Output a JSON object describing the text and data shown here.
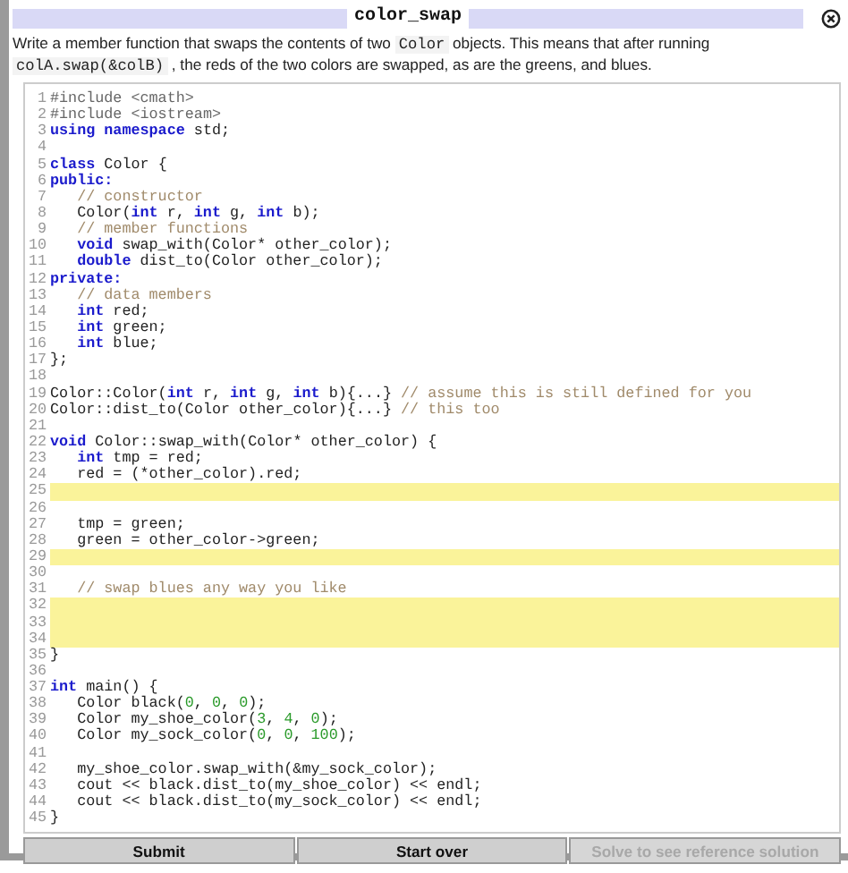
{
  "title": "color_swap",
  "description": [
    {
      "kind": "text",
      "text": "Write a member function that swaps the contents of two "
    },
    {
      "kind": "code",
      "text": "Color"
    },
    {
      "kind": "text",
      "text": " objects. This means that after running "
    },
    {
      "kind": "code",
      "text": "colA.swap(&colB)"
    },
    {
      "kind": "text",
      "text": " , the reds of the two colors are swapped, as are the greens, and blues."
    }
  ],
  "code_lines": [
    {
      "number": "1",
      "highlighted": false,
      "indented": false,
      "tokens": [
        {
          "kind": "preprocessor",
          "text": "#include <cmath>"
        }
      ]
    },
    {
      "number": "2",
      "highlighted": false,
      "indented": false,
      "tokens": [
        {
          "kind": "preprocessor",
          "text": "#include <iostream>"
        }
      ]
    },
    {
      "number": "3",
      "highlighted": false,
      "indented": false,
      "tokens": [
        {
          "kind": "keyword",
          "text": "using namespace"
        },
        {
          "kind": "plain",
          "text": " std;"
        }
      ]
    },
    {
      "number": "4",
      "highlighted": false
    },
    {
      "number": "5",
      "highlighted": false,
      "indented": false,
      "tokens": [
        {
          "kind": "keyword",
          "text": "class"
        },
        {
          "kind": "plain",
          "text": " Color {"
        }
      ]
    },
    {
      "number": "6",
      "highlighted": false,
      "indented": false,
      "tokens": [
        {
          "kind": "keyword",
          "text": "public:"
        }
      ]
    },
    {
      "number": "7",
      "highlighted": false,
      "indented": true,
      "tokens": [
        {
          "kind": "comment",
          "text": "// constructor"
        }
      ]
    },
    {
      "number": "8",
      "highlighted": false,
      "indented": true,
      "tokens": [
        {
          "kind": "plain",
          "text": "Color("
        },
        {
          "kind": "keyword",
          "text": "int"
        },
        {
          "kind": "plain",
          "text": " r, "
        },
        {
          "kind": "keyword",
          "text": "int"
        },
        {
          "kind": "plain",
          "text": " g, "
        },
        {
          "kind": "keyword",
          "text": "int"
        },
        {
          "kind": "plain",
          "text": " b);"
        }
      ]
    },
    {
      "number": "9",
      "highlighted": false,
      "indented": true,
      "tokens": [
        {
          "kind": "comment",
          "text": "// member functions"
        }
      ]
    },
    {
      "number": "10",
      "highlighted": false,
      "indented": true,
      "tokens": [
        {
          "kind": "keyword",
          "text": "void"
        },
        {
          "kind": "plain",
          "text": " swap_with(Color* other_color);"
        }
      ]
    },
    {
      "number": "11",
      "highlighted": false,
      "indented": true,
      "tokens": [
        {
          "kind": "keyword",
          "text": "double"
        },
        {
          "kind": "plain",
          "text": " dist_to(Color other_color);"
        }
      ]
    },
    {
      "number": "12",
      "highlighted": false,
      "indented": false,
      "tokens": [
        {
          "kind": "keyword",
          "text": "private:"
        }
      ]
    },
    {
      "number": "13",
      "highlighted": false,
      "indented": true,
      "tokens": [
        {
          "kind": "comment",
          "text": "// data members"
        }
      ]
    },
    {
      "number": "14",
      "highlighted": false,
      "indented": true,
      "tokens": [
        {
          "kind": "keyword",
          "text": "int"
        },
        {
          "kind": "plain",
          "text": " red;"
        }
      ]
    },
    {
      "number": "15",
      "highlighted": false,
      "indented": true,
      "tokens": [
        {
          "kind": "keyword",
          "text": "int"
        },
        {
          "kind": "plain",
          "text": " green;"
        }
      ]
    },
    {
      "number": "16",
      "highlighted": false,
      "indented": true,
      "tokens": [
        {
          "kind": "keyword",
          "text": "int"
        },
        {
          "kind": "plain",
          "text": " blue;"
        }
      ]
    },
    {
      "number": "17",
      "highlighted": false,
      "indented": false,
      "tokens": [
        {
          "kind": "plain",
          "text": "};"
        }
      ]
    },
    {
      "number": "18",
      "highlighted": false
    },
    {
      "number": "19",
      "highlighted": false,
      "indented": false,
      "tokens": [
        {
          "kind": "plain",
          "text": "Color::Color("
        },
        {
          "kind": "keyword",
          "text": "int"
        },
        {
          "kind": "plain",
          "text": " r, "
        },
        {
          "kind": "keyword",
          "text": "int"
        },
        {
          "kind": "plain",
          "text": " g, "
        },
        {
          "kind": "keyword",
          "text": "int"
        },
        {
          "kind": "plain",
          "text": " b){...} "
        },
        {
          "kind": "comment",
          "text": "// assume this is still defined for you"
        }
      ]
    },
    {
      "number": "20",
      "highlighted": false,
      "indented": false,
      "tokens": [
        {
          "kind": "plain",
          "text": "Color::dist_to(Color other_color){...} "
        },
        {
          "kind": "comment",
          "text": "// this too"
        }
      ]
    },
    {
      "number": "21",
      "highlighted": false
    },
    {
      "number": "22",
      "highlighted": false,
      "indented": false,
      "tokens": [
        {
          "kind": "keyword",
          "text": "void"
        },
        {
          "kind": "plain",
          "text": " Color::swap_with(Color* other_color) {"
        }
      ]
    },
    {
      "number": "23",
      "highlighted": false,
      "indented": true,
      "tokens": [
        {
          "kind": "keyword",
          "text": "int"
        },
        {
          "kind": "plain",
          "text": " tmp = red;"
        }
      ]
    },
    {
      "number": "24",
      "highlighted": false,
      "indented": true,
      "tokens": [
        {
          "kind": "plain",
          "text": "red = (*other_color).red;"
        }
      ]
    },
    {
      "number": "25",
      "highlighted": true,
      "indented": false
    },
    {
      "number": "26",
      "highlighted": false
    },
    {
      "number": "27",
      "highlighted": false,
      "indented": true,
      "tokens": [
        {
          "kind": "plain",
          "text": "tmp = green;"
        }
      ]
    },
    {
      "number": "28",
      "highlighted": false,
      "indented": true,
      "tokens": [
        {
          "kind": "plain",
          "text": "green = other_color->green;"
        }
      ]
    },
    {
      "number": "29",
      "highlighted": true,
      "indented": false
    },
    {
      "number": "30",
      "highlighted": false
    },
    {
      "number": "31",
      "highlighted": false,
      "indented": true,
      "tokens": [
        {
          "kind": "comment",
          "text": "// swap blues any way you like"
        }
      ]
    },
    {
      "number": "32",
      "highlighted": true,
      "indented": false
    },
    {
      "number": "33",
      "highlighted": true,
      "indented": false
    },
    {
      "number": "34",
      "highlighted": true,
      "indented": false
    },
    {
      "number": "35",
      "highlighted": false,
      "indented": false,
      "tokens": [
        {
          "kind": "plain",
          "text": "}"
        }
      ]
    },
    {
      "number": "36",
      "highlighted": false
    },
    {
      "number": "37",
      "highlighted": false,
      "indented": false,
      "tokens": [
        {
          "kind": "keyword",
          "text": "int"
        },
        {
          "kind": "plain",
          "text": " main() {"
        }
      ]
    },
    {
      "number": "38",
      "highlighted": false,
      "indented": true,
      "tokens": [
        {
          "kind": "plain",
          "text": "Color black("
        },
        {
          "kind": "number",
          "text": "0"
        },
        {
          "kind": "plain",
          "text": ", "
        },
        {
          "kind": "number",
          "text": "0"
        },
        {
          "kind": "plain",
          "text": ", "
        },
        {
          "kind": "number",
          "text": "0"
        },
        {
          "kind": "plain",
          "text": ");"
        }
      ]
    },
    {
      "number": "39",
      "highlighted": false,
      "indented": true,
      "tokens": [
        {
          "kind": "plain",
          "text": "Color my_shoe_color("
        },
        {
          "kind": "number",
          "text": "3"
        },
        {
          "kind": "plain",
          "text": ", "
        },
        {
          "kind": "number",
          "text": "4"
        },
        {
          "kind": "plain",
          "text": ", "
        },
        {
          "kind": "number",
          "text": "0"
        },
        {
          "kind": "plain",
          "text": ");"
        }
      ]
    },
    {
      "number": "40",
      "highlighted": false,
      "indented": true,
      "tokens": [
        {
          "kind": "plain",
          "text": "Color my_sock_color("
        },
        {
          "kind": "number",
          "text": "0"
        },
        {
          "kind": "plain",
          "text": ", "
        },
        {
          "kind": "number",
          "text": "0"
        },
        {
          "kind": "plain",
          "text": ", "
        },
        {
          "kind": "number",
          "text": "100"
        },
        {
          "kind": "plain",
          "text": ");"
        }
      ]
    },
    {
      "number": "41",
      "highlighted": false
    },
    {
      "number": "42",
      "highlighted": false,
      "indented": true,
      "tokens": [
        {
          "kind": "plain",
          "text": "my_shoe_color.swap_with(&my_sock_color);"
        }
      ]
    },
    {
      "number": "43",
      "highlighted": false,
      "indented": true,
      "tokens": [
        {
          "kind": "plain",
          "text": "cout << black.dist_to(my_shoe_color) << endl;"
        }
      ]
    },
    {
      "number": "44",
      "highlighted": false,
      "indented": true,
      "tokens": [
        {
          "kind": "plain",
          "text": "cout << black.dist_to(my_sock_color) << endl;"
        }
      ]
    },
    {
      "number": "45",
      "highlighted": false,
      "indented": false,
      "tokens": [
        {
          "kind": "plain",
          "text": "}"
        }
      ]
    }
  ],
  "buttons": [
    {
      "label": "Submit",
      "disabled": false
    },
    {
      "label": "Start over",
      "disabled": false
    },
    {
      "label": "Solve to see reference solution",
      "disabled": true
    }
  ]
}
